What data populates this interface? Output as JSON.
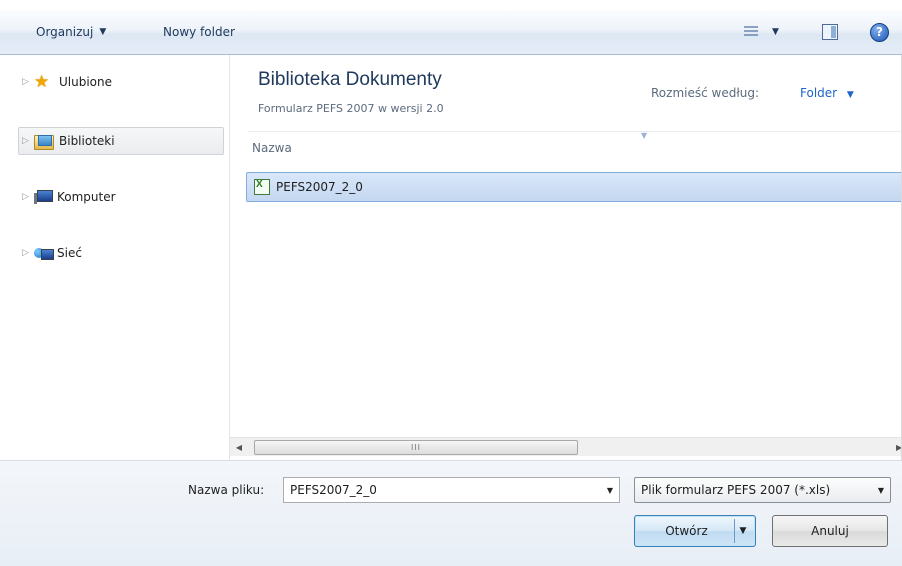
{
  "toolbar": {
    "organize_label": "Organizuj",
    "new_folder_label": "Nowy folder",
    "help_glyph": "?"
  },
  "sidebar": {
    "items": [
      {
        "label": "Ulubione",
        "icon": "star-icon"
      },
      {
        "label": "Biblioteki",
        "icon": "library-icon",
        "selected": true
      },
      {
        "label": "Komputer",
        "icon": "computer-icon"
      },
      {
        "label": "Sieć",
        "icon": "network-icon"
      }
    ]
  },
  "library": {
    "title": "Biblioteka Dokumenty",
    "subtitle": "Formularz PEFS 2007 w wersji 2.0",
    "arrange_label": "Rozmieść według:",
    "arrange_value": "Folder"
  },
  "file_list": {
    "column_header": "Nazwa",
    "files": [
      {
        "name": "PEFS2007_2_0",
        "icon": "excel-file-icon",
        "selected": true
      }
    ]
  },
  "scrollbar": {
    "thumb_grip": "III"
  },
  "footer": {
    "filename_label": "Nazwa pliku:",
    "filename_value": "PEFS2007_2_0",
    "filter_value": "Plik formularz PEFS 2007 (*.xls)",
    "open_label": "Otwórz",
    "cancel_label": "Anuluj"
  },
  "colors": {
    "toolbar_text": "#1e395b",
    "link_blue": "#1e66c8",
    "selection": "#c4d8f1"
  }
}
